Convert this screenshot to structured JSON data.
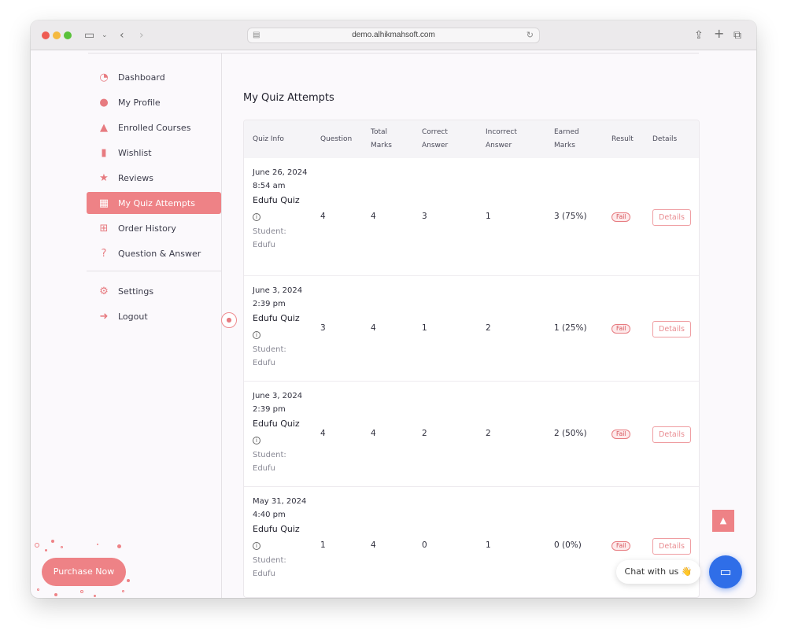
{
  "browser": {
    "url": "demo.alhikmahsoft.com"
  },
  "sidebar": {
    "items": [
      {
        "label": "Dashboard",
        "icon": "dashboard-icon",
        "glyph": "◔"
      },
      {
        "label": "My Profile",
        "icon": "user-icon",
        "glyph": "●"
      },
      {
        "label": "Enrolled Courses",
        "icon": "graduation-cap-icon",
        "glyph": "▲"
      },
      {
        "label": "Wishlist",
        "icon": "bookmark-icon",
        "glyph": "▮"
      },
      {
        "label": "Reviews",
        "icon": "star-icon",
        "glyph": "★"
      },
      {
        "label": "My Quiz Attempts",
        "icon": "quiz-icon",
        "glyph": "▦"
      },
      {
        "label": "Order History",
        "icon": "cart-icon",
        "glyph": "⊞"
      },
      {
        "label": "Question & Answer",
        "icon": "question-icon",
        "glyph": "?"
      }
    ],
    "bottom_items": [
      {
        "label": "Settings",
        "icon": "gear-icon",
        "glyph": "⚙"
      },
      {
        "label": "Logout",
        "icon": "logout-icon",
        "glyph": "➜"
      }
    ],
    "active": "My Quiz Attempts"
  },
  "page": {
    "title": "My Quiz Attempts"
  },
  "table": {
    "headers": [
      "Quiz Info",
      "Question",
      "Total\nMarks",
      "Correct\nAnswer",
      "Incorrect\nAnswer",
      "Earned\nMarks",
      "Result",
      "Details"
    ],
    "rows": [
      {
        "date": "June 26, 2024 8:54 am",
        "quiz": "Edufu Quiz",
        "student": "Student: Edufu",
        "question": "4",
        "total": "4",
        "correct": "3",
        "incorrect": "1",
        "earned": "3 (75%)",
        "result": "Fail",
        "details": "Details"
      },
      {
        "date": "June 3, 2024 2:39 pm",
        "quiz": "Edufu Quiz",
        "student": "Student: Edufu",
        "question": "3",
        "total": "4",
        "correct": "1",
        "incorrect": "2",
        "earned": "1 (25%)",
        "result": "Fail",
        "details": "Details"
      },
      {
        "date": "June 3, 2024 2:39 pm",
        "quiz": "Edufu Quiz",
        "student": "Student: Edufu",
        "question": "4",
        "total": "4",
        "correct": "2",
        "incorrect": "2",
        "earned": "2 (50%)",
        "result": "Fail",
        "details": "Details"
      },
      {
        "date": "May 31, 2024 4:40 pm",
        "quiz": "Edufu Quiz",
        "student": "Student: Edufu",
        "question": "1",
        "total": "4",
        "correct": "0",
        "incorrect": "1",
        "earned": "0 (0%)",
        "result": "Fail",
        "details": "Details"
      }
    ]
  },
  "purchase": {
    "label": "Purchase Now"
  },
  "chat": {
    "label": "Chat with us 👋"
  },
  "colors": {
    "accent": "#ee8286",
    "chat": "#2f6ee8"
  }
}
